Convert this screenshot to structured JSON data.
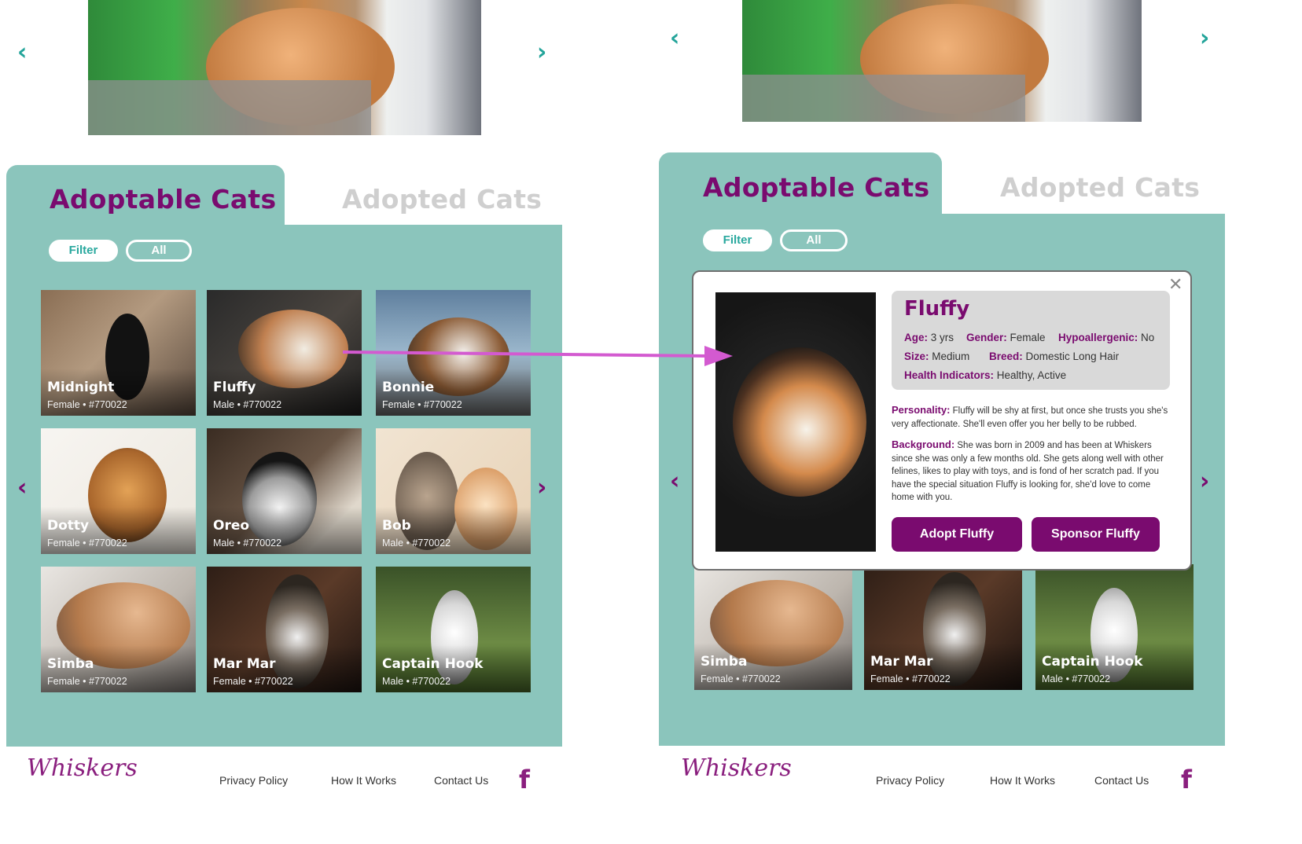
{
  "nav": {
    "prev_icon": "chevron-left-icon",
    "next_icon": "chevron-right-icon",
    "prev_glyph": "‹",
    "next_glyph": "›"
  },
  "tabs": {
    "active_label": "Adoptable Cats",
    "inactive_label": "Adopted Cats"
  },
  "filters": {
    "filter_label": "Filter",
    "all_label": "All"
  },
  "cats": [
    {
      "name": "Midnight",
      "meta": "Female • #770022"
    },
    {
      "name": "Fluffy",
      "meta": "Male • #770022"
    },
    {
      "name": "Bonnie",
      "meta": "Female • #770022"
    },
    {
      "name": "Dotty",
      "meta": "Female • #770022"
    },
    {
      "name": "Oreo",
      "meta": "Male • #770022"
    },
    {
      "name": "Bob",
      "meta": "Male • #770022"
    },
    {
      "name": "Simba",
      "meta": "Female • #770022"
    },
    {
      "name": "Mar Mar",
      "meta": "Female • #770022"
    },
    {
      "name": "Captain Hook",
      "meta": "Male • #770022"
    }
  ],
  "modal": {
    "name": "Fluffy",
    "close_glyph": "✕",
    "age_label": "Age:",
    "age": "3 yrs",
    "gender_label": "Gender:",
    "gender": "Female",
    "hypo_label": "Hypoallergenic:",
    "hypo": "No",
    "size_label": "Size:",
    "size": "Medium",
    "breed_label": "Breed:",
    "breed": "Domestic Long Hair",
    "health_label": "Health Indicators:",
    "health": "Healthy, Active",
    "personality_label": "Personality:",
    "personality": "Fluffy will be shy at first, but once she trusts you she's very affectionate. She'll even offer you her belly to be rubbed.",
    "background_label": "Background:",
    "background": "She was born in 2009 and has been at Whiskers since she was only a few months old. She gets along well with other felines, likes to play with toys, and is fond of her scratch pad. If you have the special situation Fluffy is looking for, she'd love to come home with you.",
    "adopt_label": "Adopt Fluffy",
    "sponsor_label": "Sponsor Fluffy"
  },
  "footer": {
    "logo_text": "Whiskers",
    "privacy": "Privacy Policy",
    "how": "How It Works",
    "contact": "Contact Us",
    "facebook_glyph": "f"
  },
  "colors": {
    "teal": "#8bc5bc",
    "accent_teal": "#23a49a",
    "purple": "#7a0b6f"
  }
}
